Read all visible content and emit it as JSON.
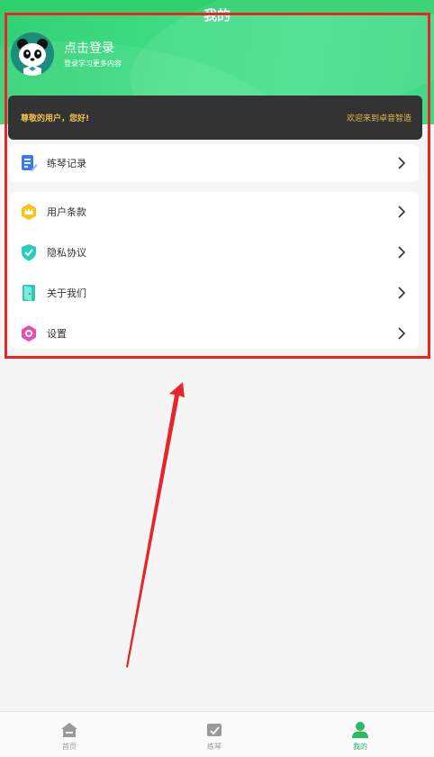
{
  "header": {
    "title": "我的"
  },
  "profile": {
    "title": "点击登录",
    "subtitle": "登录学习更多内容"
  },
  "banner": {
    "greeting": "尊敬的用户，您好!",
    "welcome": "欢迎来到卓音智造"
  },
  "menu_primary": [
    {
      "label": "练琴记录",
      "icon": "document-edit-icon"
    }
  ],
  "menu_secondary": [
    {
      "label": "用户条款",
      "icon": "crown-badge-icon"
    },
    {
      "label": "隐私协议",
      "icon": "shield-check-icon"
    },
    {
      "label": "关于我们",
      "icon": "door-icon"
    },
    {
      "label": "设置",
      "icon": "gear-hexagon-icon"
    }
  ],
  "tabbar": [
    {
      "label": "首页",
      "icon": "home-icon",
      "active": false
    },
    {
      "label": "练琴",
      "icon": "practice-icon",
      "active": false
    },
    {
      "label": "我的",
      "icon": "user-icon",
      "active": true
    }
  ],
  "colors": {
    "brand_green": "#2db964",
    "banner_dark": "#333333",
    "banner_gold": "#f2c14a",
    "annotation_red": "#e6262b"
  }
}
